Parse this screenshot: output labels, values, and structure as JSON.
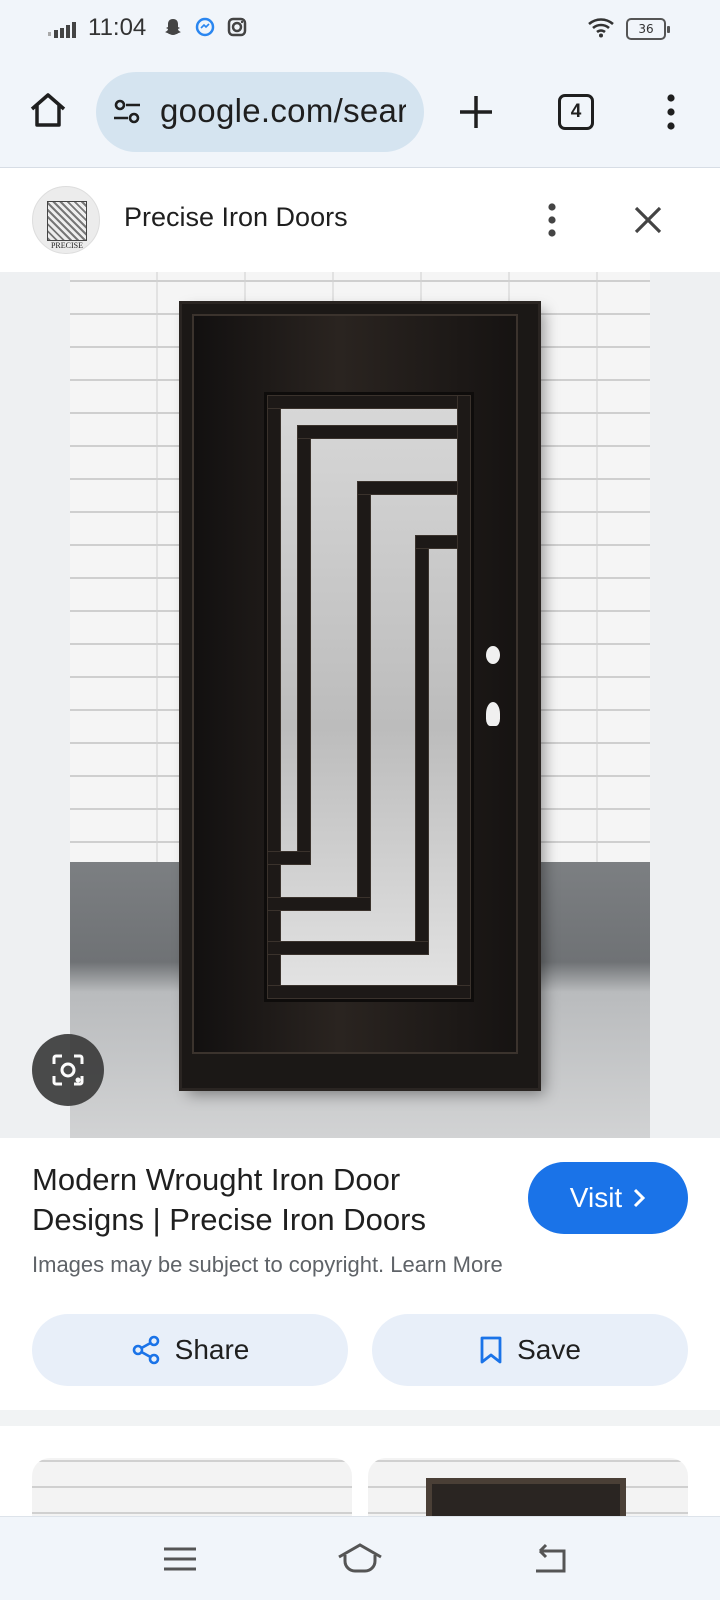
{
  "status_bar": {
    "time": "11:04",
    "battery": "36",
    "icons": [
      "signal-icon",
      "snapchat-icon",
      "messenger-icon",
      "instagram-icon",
      "wifi-icon",
      "battery-icon"
    ]
  },
  "browser": {
    "url": "google.com/search",
    "tab_count": "4",
    "icons": [
      "home-icon",
      "site-settings-icon",
      "new-tab-icon",
      "tab-switcher-icon",
      "overflow-menu-icon"
    ]
  },
  "source": {
    "name": "Precise Iron Doors",
    "logo_text": "PRECISE"
  },
  "result": {
    "title": "Modern Wrought Iron Door Designs | Precise Iron Doors",
    "copyright_text": "Images may be subject to copyright. Learn More",
    "visit_label": "Visit",
    "share_label": "Share",
    "save_label": "Save"
  },
  "colors": {
    "accent": "#1a73e8",
    "chrome_bg": "#f1f5fa",
    "url_bar_bg": "#d5e4f0",
    "action_btn_bg": "#e8eff9"
  }
}
